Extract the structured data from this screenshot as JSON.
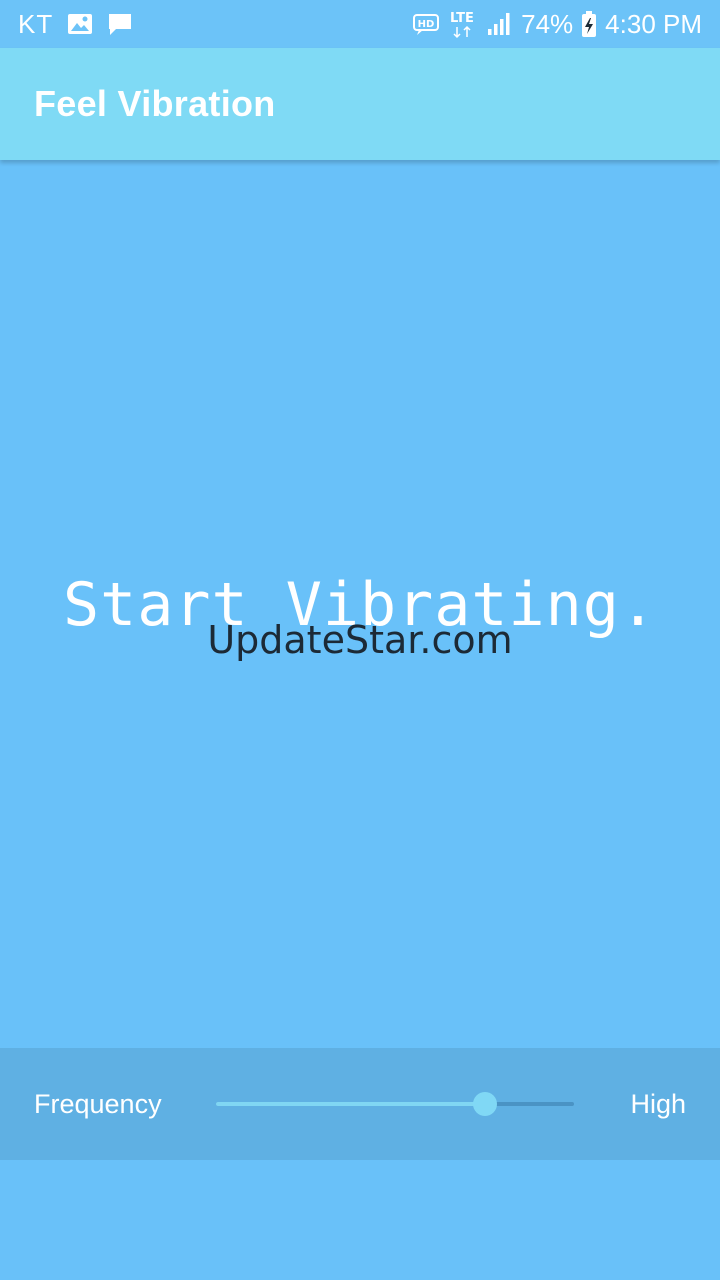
{
  "status_bar": {
    "carrier": "KT",
    "network": "LTE",
    "hd_badge": "HD",
    "battery": "74%",
    "time": "4:30 PM",
    "icons": [
      "image-icon",
      "message-icon",
      "hd-icon",
      "lte-icon",
      "signal-icon",
      "battery-charging-icon"
    ]
  },
  "app_bar": {
    "title": "Feel Vibration"
  },
  "main": {
    "start_text": "Start Vibrating.",
    "watermark": "UpdateStar.com"
  },
  "frequency": {
    "label": "Frequency",
    "level_label": "High",
    "slider_value": 0.75
  },
  "colors": {
    "background": "#69c1f9",
    "app_bar": "#7fdaf5",
    "panel": "#5fb0e3",
    "accent": "#80d8f5"
  }
}
